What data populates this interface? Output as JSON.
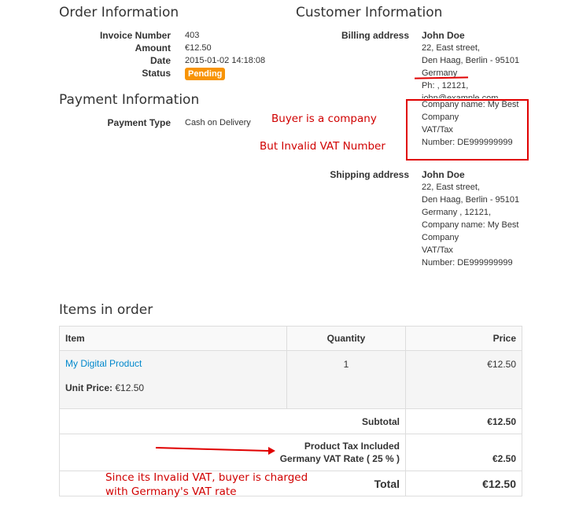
{
  "order": {
    "title": "Order Information",
    "invoice_label": "Invoice Number",
    "invoice_value": "403",
    "amount_label": "Amount",
    "amount_value": "€12.50",
    "date_label": "Date",
    "date_value": "2015-01-02 14:18:08",
    "status_label": "Status",
    "status_value": "Pending",
    "status_color": "#f89406"
  },
  "payment": {
    "title": "Payment Information",
    "type_label": "Payment Type",
    "type_value": "Cash on Delivery"
  },
  "customer": {
    "title": "Customer Information",
    "billing_label": "Billing address",
    "billing_lines": [
      "John Doe",
      "22, East street,",
      "Den Haag, Berlin - 95101",
      "Germany",
      "Ph: , 12121,",
      "john@example.com",
      "Company name: My Best",
      "Company",
      "VAT/Tax",
      "Number: DE999999999"
    ],
    "shipping_label": "Shipping address",
    "shipping_lines": [
      "John Doe",
      "22, East street,",
      "Den Haag, Berlin - 95101",
      "Germany , 12121,",
      "Company name: My Best",
      "Company",
      "VAT/Tax",
      "Number: DE999999999"
    ]
  },
  "annotations": {
    "buyer_company": "Buyer is a company",
    "invalid_vat": "But Invalid VAT Number",
    "charged_line1": "Since its Invalid VAT, buyer is charged",
    "charged_line2": "with Germany's VAT rate",
    "color": "#d00000"
  },
  "items": {
    "title": "Items in order",
    "headers": {
      "item": "Item",
      "quantity": "Quantity",
      "price": "Price"
    },
    "rows": [
      {
        "name": "My Digital Product",
        "unit_price_label": "Unit Price:",
        "unit_price": "€12.50",
        "quantity": "1",
        "price": "€12.50"
      }
    ],
    "subtotal_label": "Subtotal",
    "subtotal_value": "€12.50",
    "tax_label_line1": "Product Tax Included",
    "tax_label_line2": "Germany VAT Rate ( 25 % )",
    "tax_value": "€2.50",
    "total_label": "Total",
    "total_value": "€12.50"
  }
}
